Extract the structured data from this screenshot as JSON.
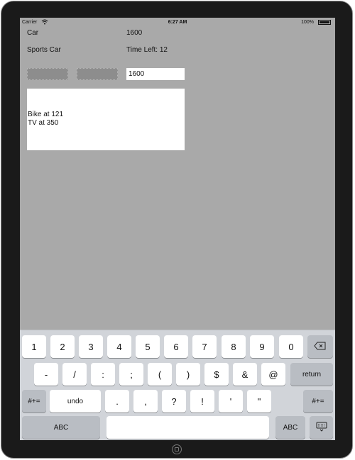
{
  "status_bar": {
    "carrier": "Carrier",
    "time": "6:27 AM",
    "battery": "100%"
  },
  "app": {
    "item_name": "Car",
    "item_value": "1600",
    "item_category": "Sports Car",
    "time_left": "Time Left: 12",
    "bid_field_value": "1600",
    "log_lines": [
      "Bike at 121",
      "TV at 350"
    ]
  },
  "keyboard": {
    "row1": [
      "1",
      "2",
      "3",
      "4",
      "5",
      "6",
      "7",
      "8",
      "9",
      "0"
    ],
    "row2": [
      "-",
      "/",
      ":",
      ";",
      "(",
      ")",
      "$",
      "&",
      "@"
    ],
    "return_label": "return",
    "shift_symbols_label": "#+=",
    "undo_label": "undo",
    "row3": [
      ".",
      ",",
      "?",
      "!",
      "'",
      "\""
    ],
    "abc_label": "ABC"
  },
  "icons": {
    "wifi": "wifi-icon",
    "battery": "battery-icon",
    "delete": "backspace-icon",
    "hide_keyboard": "keyboard-hide-icon",
    "home": "home-button-icon"
  }
}
